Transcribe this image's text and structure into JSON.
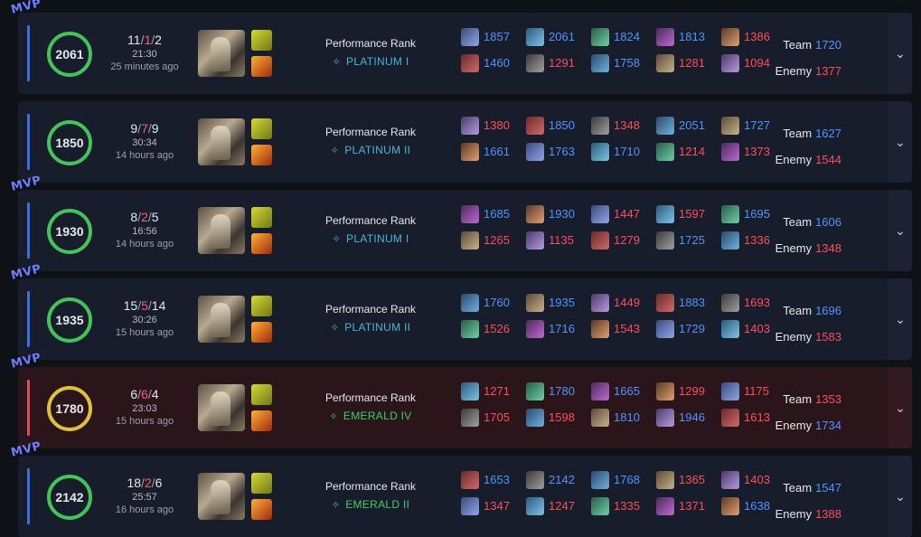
{
  "mvp_label": "MVP",
  "perf_label": "Performance Rank",
  "team_label": "Team",
  "enemy_label": "Enemy",
  "expand_icon": "chevron-down-icon",
  "colors": {
    "win_ring": "#43c35a",
    "loss_ring": "#e0c23a",
    "blue": "#5393ff",
    "red": "#ff4d5e"
  },
  "matches": [
    {
      "result": "win",
      "mvp": true,
      "score": "2061",
      "kills": "11",
      "deaths": "1",
      "assists": "2",
      "duration": "21:30",
      "ago": "25 minutes ago",
      "rank": "PLATINUM I",
      "rank_tier": "plat",
      "team_players": [
        "1857",
        "2061",
        "1824",
        "1813",
        "1386"
      ],
      "enemy_players": [
        "1460",
        "1291",
        "1758",
        "1281",
        "1094"
      ],
      "team_colors": [
        "blue",
        "blue",
        "blue",
        "blue",
        "red"
      ],
      "enemy_colors": [
        "blue",
        "red",
        "blue",
        "red",
        "red"
      ],
      "team_avg": "1720",
      "enemy_avg": "1377",
      "team_avg_color": "blue",
      "enemy_avg_color": "red"
    },
    {
      "result": "win",
      "mvp": false,
      "score": "1850",
      "kills": "9",
      "deaths": "7",
      "assists": "9",
      "duration": "30:34",
      "ago": "14 hours ago",
      "rank": "PLATINUM II",
      "rank_tier": "plat",
      "team_players": [
        "1380",
        "1850",
        "1348",
        "2051",
        "1727"
      ],
      "enemy_players": [
        "1661",
        "1763",
        "1710",
        "1214",
        "1373"
      ],
      "team_colors": [
        "red",
        "blue",
        "red",
        "blue",
        "blue"
      ],
      "enemy_colors": [
        "blue",
        "blue",
        "blue",
        "red",
        "red"
      ],
      "team_avg": "1627",
      "enemy_avg": "1544",
      "team_avg_color": "blue",
      "enemy_avg_color": "red"
    },
    {
      "result": "win",
      "mvp": true,
      "score": "1930",
      "kills": "8",
      "deaths": "2",
      "assists": "5",
      "duration": "16:56",
      "ago": "14 hours ago",
      "rank": "PLATINUM I",
      "rank_tier": "plat",
      "team_players": [
        "1685",
        "1930",
        "1447",
        "1597",
        "1695"
      ],
      "enemy_players": [
        "1265",
        "1135",
        "1279",
        "1725",
        "1336"
      ],
      "team_colors": [
        "blue",
        "blue",
        "red",
        "red",
        "blue"
      ],
      "enemy_colors": [
        "red",
        "red",
        "red",
        "blue",
        "red"
      ],
      "team_avg": "1606",
      "enemy_avg": "1348",
      "team_avg_color": "blue",
      "enemy_avg_color": "red"
    },
    {
      "result": "win",
      "mvp": true,
      "score": "1935",
      "kills": "15",
      "deaths": "5",
      "assists": "14",
      "duration": "30:26",
      "ago": "15 hours ago",
      "rank": "PLATINUM II",
      "rank_tier": "plat",
      "team_players": [
        "1760",
        "1935",
        "1449",
        "1883",
        "1693"
      ],
      "enemy_players": [
        "1526",
        "1716",
        "1543",
        "1729",
        "1403"
      ],
      "team_colors": [
        "blue",
        "blue",
        "red",
        "blue",
        "red"
      ],
      "enemy_colors": [
        "red",
        "blue",
        "red",
        "blue",
        "red"
      ],
      "team_avg": "1696",
      "enemy_avg": "1583",
      "team_avg_color": "blue",
      "enemy_avg_color": "red"
    },
    {
      "result": "loss",
      "mvp": true,
      "score": "1780",
      "kills": "6",
      "deaths": "6",
      "assists": "4",
      "duration": "23:03",
      "ago": "15 hours ago",
      "rank": "EMERALD IV",
      "rank_tier": "emer",
      "team_players": [
        "1271",
        "1780",
        "1665",
        "1299",
        "1175"
      ],
      "enemy_players": [
        "1705",
        "1598",
        "1810",
        "1946",
        "1613"
      ],
      "team_colors": [
        "red",
        "blue",
        "blue",
        "red",
        "red"
      ],
      "enemy_colors": [
        "red",
        "red",
        "blue",
        "blue",
        "red"
      ],
      "team_avg": "1353",
      "enemy_avg": "1734",
      "team_avg_color": "red",
      "enemy_avg_color": "blue"
    },
    {
      "result": "win",
      "mvp": true,
      "score": "2142",
      "kills": "18",
      "deaths": "2",
      "assists": "6",
      "duration": "25:57",
      "ago": "16 hours ago",
      "rank": "EMERALD II",
      "rank_tier": "emer",
      "team_players": [
        "1653",
        "2142",
        "1768",
        "1365",
        "1403"
      ],
      "enemy_players": [
        "1347",
        "1247",
        "1335",
        "1371",
        "1638"
      ],
      "team_colors": [
        "blue",
        "blue",
        "blue",
        "red",
        "red"
      ],
      "enemy_colors": [
        "red",
        "red",
        "red",
        "red",
        "blue"
      ],
      "team_avg": "1547",
      "enemy_avg": "1388",
      "team_avg_color": "blue",
      "enemy_avg_color": "red"
    }
  ]
}
